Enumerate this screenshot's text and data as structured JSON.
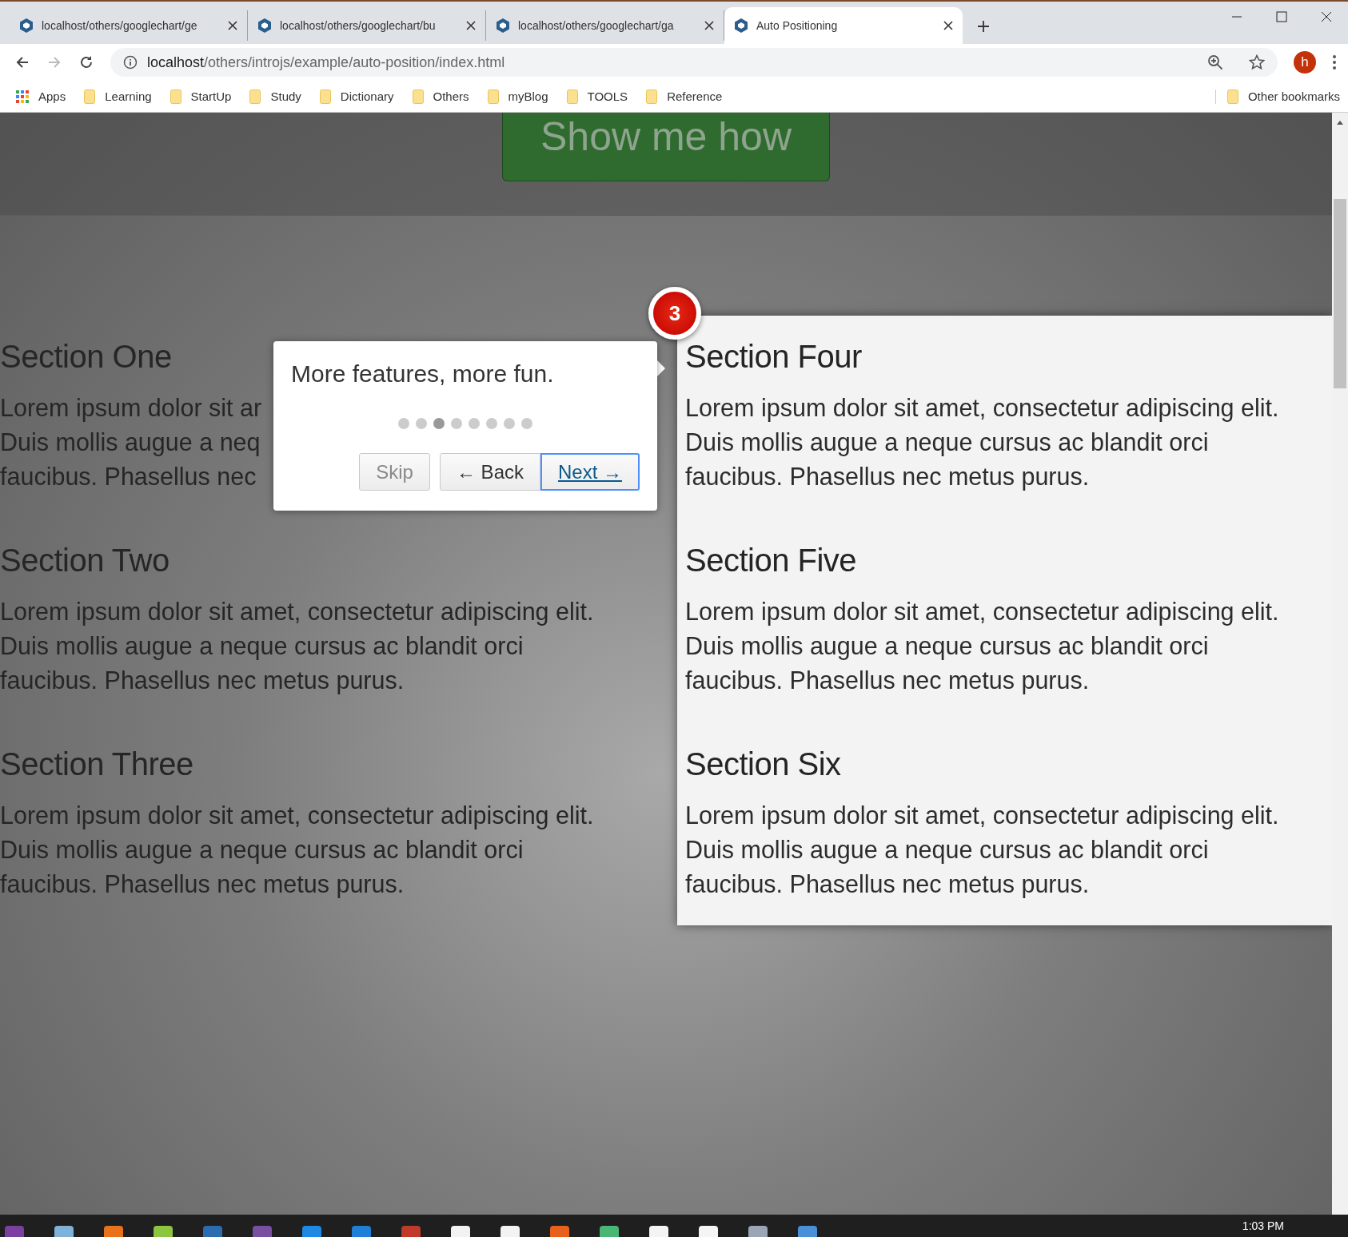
{
  "browser": {
    "tabs": [
      {
        "title": "localhost/others/googlechart/ge",
        "selected": false
      },
      {
        "title": "localhost/others/googlechart/bu",
        "selected": false
      },
      {
        "title": "localhost/others/googlechart/ga",
        "selected": false
      },
      {
        "title": "Auto Positioning",
        "selected": true
      }
    ],
    "nav": [
      {
        "kind": "back",
        "disabled": false
      },
      {
        "kind": "forward",
        "disabled": true
      },
      {
        "kind": "reload",
        "disabled": false
      }
    ],
    "address": {
      "host": "localhost",
      "path": "/others/introjs/example/auto-position/index.html"
    },
    "avatar": "h",
    "bookmarks": [
      {
        "kind": "apps",
        "label": "Apps"
      },
      {
        "kind": "folder",
        "label": "Learning"
      },
      {
        "kind": "folder",
        "label": "StartUp"
      },
      {
        "kind": "folder",
        "label": "Study"
      },
      {
        "kind": "folder",
        "label": "Dictionary"
      },
      {
        "kind": "folder",
        "label": "Others"
      },
      {
        "kind": "folder",
        "label": "myBlog"
      },
      {
        "kind": "folder",
        "label": "TOOLS"
      },
      {
        "kind": "folder",
        "label": "Reference"
      }
    ],
    "other_bookmarks": "Other bookmarks"
  },
  "page": {
    "hero_button": "Show me how",
    "left_sections": [
      {
        "heading": "Section One",
        "lines": [
          "Lorem ipsum dolor sit ar",
          "Duis mollis augue a neq",
          "faucibus. Phasellus nec"
        ]
      },
      {
        "heading": "Section Two",
        "lines": [
          "Lorem ipsum dolor sit amet, consectetur adipiscing elit.",
          "Duis mollis augue a neque cursus ac blandit orci",
          "faucibus. Phasellus nec metus purus."
        ]
      },
      {
        "heading": "Section Three",
        "lines": [
          "Lorem ipsum dolor sit amet, consectetur adipiscing elit.",
          "Duis mollis augue a neque cursus ac blandit orci",
          "faucibus. Phasellus nec metus purus."
        ]
      }
    ],
    "panel_sections": [
      {
        "heading": "Section Four",
        "lines": [
          "Lorem ipsum dolor sit amet, consectetur adipiscing elit.",
          "Duis mollis augue a neque cursus ac blandit orci",
          "faucibus. Phasellus nec metus purus."
        ]
      },
      {
        "heading": "Section Five",
        "lines": [
          "Lorem ipsum dolor sit amet, consectetur adipiscing elit.",
          "Duis mollis augue a neque cursus ac blandit orci",
          "faucibus. Phasellus nec metus purus."
        ]
      },
      {
        "heading": "Section Six",
        "lines": [
          "Lorem ipsum dolor sit amet, consectetur adipiscing elit.",
          "Duis mollis augue a neque cursus ac blandit orci",
          "faucibus. Phasellus nec metus purus."
        ]
      }
    ],
    "tour": {
      "step_number": "3",
      "text": "More features, more fun.",
      "steps": [
        {
          "selected": false
        },
        {
          "selected": false
        },
        {
          "selected": true
        },
        {
          "selected": false
        },
        {
          "selected": false
        },
        {
          "selected": false
        },
        {
          "selected": false
        },
        {
          "selected": false
        }
      ],
      "buttons": [
        {
          "kind": "skip",
          "label": "Skip",
          "disabled": true,
          "focused": false
        },
        {
          "kind": "back",
          "label": "← Back",
          "disabled": false,
          "focused": false
        },
        {
          "kind": "next",
          "label": "Next →",
          "disabled": false,
          "focused": true
        }
      ]
    }
  },
  "taskbar": {
    "apps": [
      {
        "color": "#7b3fa0"
      },
      {
        "color": "#7fb2d8"
      },
      {
        "color": "#e8711c"
      },
      {
        "color": "#8cc63f"
      },
      {
        "color": "#2b6cb0"
      },
      {
        "color": "#7a4ea0"
      },
      {
        "color": "#1e88e5"
      },
      {
        "color": "#1f7fd6"
      },
      {
        "color": "#c0392b"
      },
      {
        "color": "#f2f2f2"
      },
      {
        "color": "#f3f3f3"
      },
      {
        "color": "#e8611c"
      },
      {
        "color": "#49b675"
      },
      {
        "color": "#f4f4f4"
      },
      {
        "color": "#f5f5f5"
      },
      {
        "color": "#9aa5b5"
      },
      {
        "color": "#4a90d9"
      }
    ],
    "time": "1:03 PM"
  }
}
